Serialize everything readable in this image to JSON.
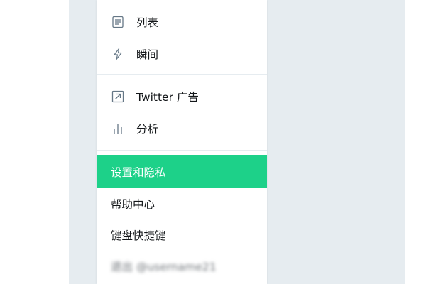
{
  "colors": {
    "background": "#e6ecf0",
    "menu_background": "#ffffff",
    "active_background": "#1dd189",
    "text": "#14171a",
    "active_text": "#ffffff",
    "icon": "#657786"
  },
  "menu": {
    "items": [
      {
        "label": "列表",
        "icon": "list-icon"
      },
      {
        "label": "瞬间",
        "icon": "lightning-icon"
      },
      {
        "label": "Twitter 广告",
        "icon": "external-arrow-icon"
      },
      {
        "label": "分析",
        "icon": "bar-chart-icon"
      }
    ],
    "links": [
      {
        "label": "设置和隐私",
        "active": true
      },
      {
        "label": "帮助中心"
      },
      {
        "label": "键盘快捷键"
      },
      {
        "label": "退出 @username21",
        "blurred": true
      }
    ]
  }
}
